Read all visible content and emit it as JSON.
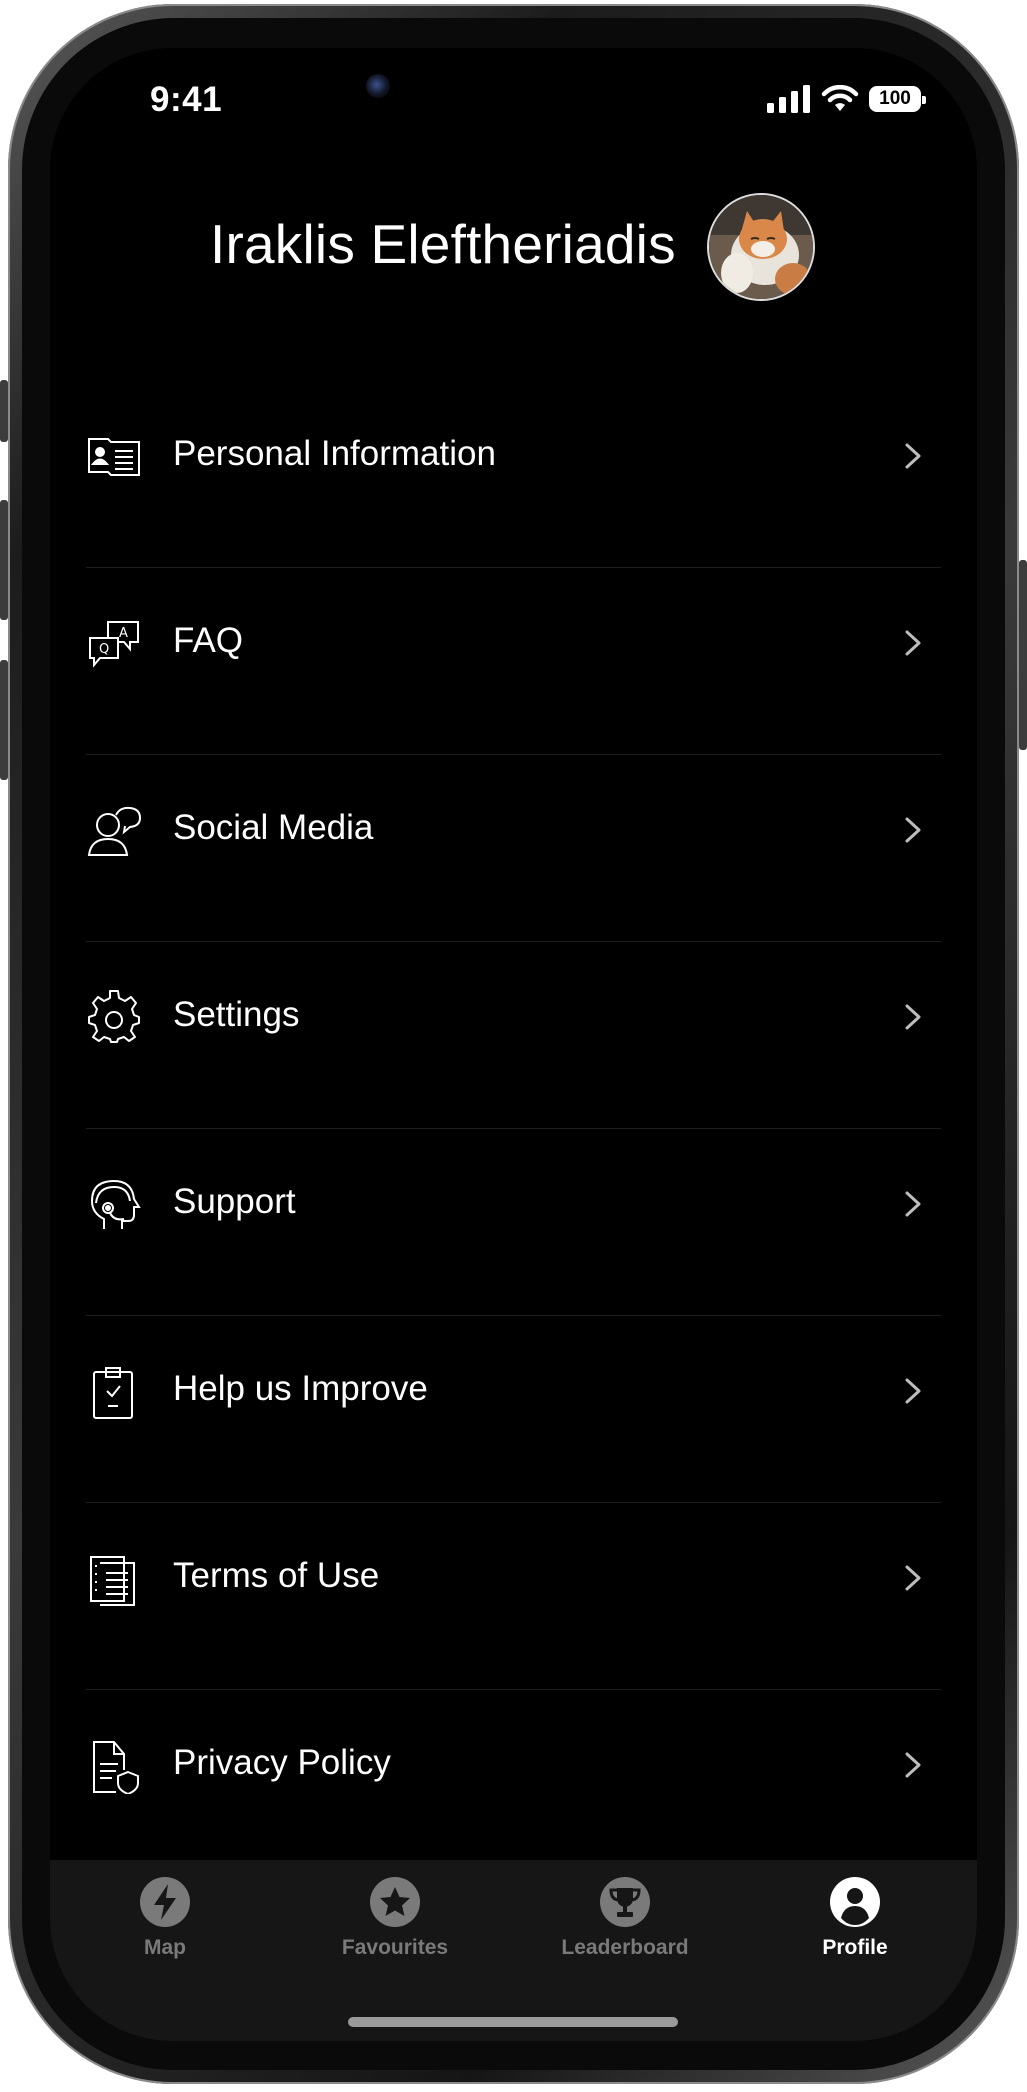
{
  "status_bar": {
    "time": "9:41",
    "battery": "100"
  },
  "profile": {
    "name": "Iraklis Eleftheriadis"
  },
  "menu": [
    {
      "label": "Personal Information",
      "icon": "id-card-icon"
    },
    {
      "label": "FAQ",
      "icon": "qa-bubbles-icon"
    },
    {
      "label": "Social Media",
      "icon": "person-speech-icon"
    },
    {
      "label": "Settings",
      "icon": "gear-icon"
    },
    {
      "label": "Support",
      "icon": "headset-agent-icon"
    },
    {
      "label": "Help us Improve",
      "icon": "clipboard-check-icon"
    },
    {
      "label": "Terms of Use",
      "icon": "document-list-icon"
    },
    {
      "label": "Privacy Policy",
      "icon": "document-shield-icon"
    }
  ],
  "tabs": [
    {
      "label": "Map",
      "icon": "lightning-bolt-icon",
      "active": false
    },
    {
      "label": "Favourites",
      "icon": "star-icon",
      "active": false
    },
    {
      "label": "Leaderboard",
      "icon": "trophy-icon",
      "active": false
    },
    {
      "label": "Profile",
      "icon": "person-icon",
      "active": true
    }
  ],
  "colors": {
    "background": "#000000",
    "tab_bar": "#161616",
    "inactive_tab": "#7a7a7a",
    "active_tab": "#ffffff"
  }
}
